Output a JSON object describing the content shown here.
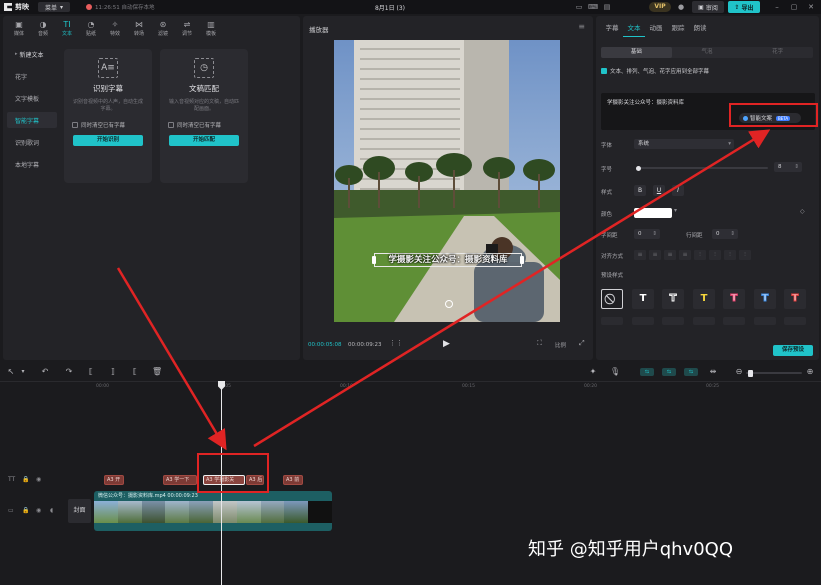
{
  "titlebar": {
    "app_name": "剪映",
    "menu_label": "菜单",
    "save_status": "11:26:51 自动保存本地",
    "doc_title": "8月1日 (3)",
    "vip": "VIP",
    "review": "审阅",
    "export": "导出"
  },
  "left_panel": {
    "tabs": [
      {
        "label": "媒体",
        "icon": "media-icon"
      },
      {
        "label": "音频",
        "icon": "audio-icon"
      },
      {
        "label": "文本",
        "icon": "text-icon"
      },
      {
        "label": "贴纸",
        "icon": "sticker-icon"
      },
      {
        "label": "特效",
        "icon": "effects-icon"
      },
      {
        "label": "转场",
        "icon": "transition-icon"
      },
      {
        "label": "滤镜",
        "icon": "filter-icon"
      },
      {
        "label": "调节",
        "icon": "adjust-icon"
      },
      {
        "label": "模板",
        "icon": "template-icon"
      }
    ],
    "side_items": [
      "新建文本",
      "花字",
      "文字模板",
      "智能字幕",
      "识别歌词",
      "本地字幕"
    ],
    "cards": [
      {
        "title": "识别字幕",
        "desc": "识别音视频中的人声，自动生成字幕。",
        "check": "同时清空已有字幕",
        "button": "开始识别"
      },
      {
        "title": "文稿匹配",
        "desc": "输入音视频对应的文稿，自动匹配画面。",
        "check": "同时清空已有字幕",
        "button": "开始匹配"
      }
    ]
  },
  "player": {
    "title": "播放器",
    "subtitle_text": "学摄影关注公众号：摄影资料库",
    "current_time": "00:00:05:08",
    "total_time": "00:00:09:23",
    "ratio_label": "比例"
  },
  "right_panel": {
    "tabs": [
      "字幕",
      "文本",
      "动画",
      "跟踪",
      "朗读"
    ],
    "sub_tabs": [
      "基础",
      "气泡",
      "花字"
    ],
    "apply_all": "文本、排列、气泡、花字应用到全部字幕",
    "text_value": "学摄影关注公众号：摄影资料库",
    "smart_btn": "智能文案",
    "beta": "BETA",
    "labels": {
      "font": "字体",
      "size": "字号",
      "style": "样式",
      "color": "颜色",
      "char_spacing": "字间距",
      "line_spacing": "行间距",
      "align": "对齐方式",
      "preset": "预设样式"
    },
    "font_value": "系统",
    "size_value": "8",
    "char_spacing_value": "0",
    "line_spacing_value": "0",
    "save_preset": "保存预设"
  },
  "timeline": {
    "ticks": [
      "00:00",
      "00:05",
      "00:10",
      "00:15",
      "00:20",
      "00:25"
    ],
    "subtitle_clips": [
      "A3 开",
      "A3 学一下",
      "A3 学摄影关",
      "A3 后",
      "A3 前"
    ],
    "cover": "封面",
    "video_clip_label": "微信公众号：摄影资料库.mp4  00:00:09:23"
  },
  "watermark": "知乎 @知乎用户qhv0QQ",
  "colors": {
    "accent": "#20c3c9",
    "annotation": "#e02424",
    "subtitle_clip": "#7d3a35",
    "video_clip": "#1d5f63"
  }
}
